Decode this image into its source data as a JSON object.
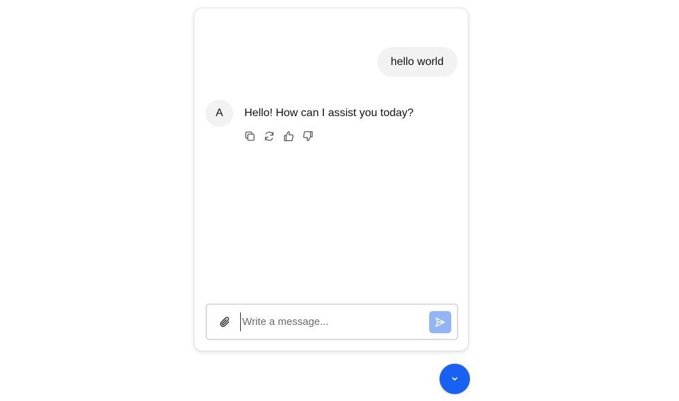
{
  "conversation": {
    "user_message": "hello world",
    "assistant": {
      "avatar_letter": "A",
      "message": "Hello! How can I assist you today?",
      "actions": [
        {
          "icon": "copy-icon"
        },
        {
          "icon": "regenerate-icon"
        },
        {
          "icon": "thumbs-up-icon"
        },
        {
          "icon": "thumbs-down-icon"
        }
      ]
    }
  },
  "composer": {
    "placeholder": "Write a message...",
    "value": "",
    "attach_icon": "paperclip-icon",
    "send_icon": "send-icon"
  },
  "scroll_button": {
    "icon": "chevron-down-icon"
  },
  "colors": {
    "accent": "#1762f2",
    "send_disabled": "#93b4f5",
    "bubble": "#f2f2f2",
    "border": "#e3e3e3"
  }
}
